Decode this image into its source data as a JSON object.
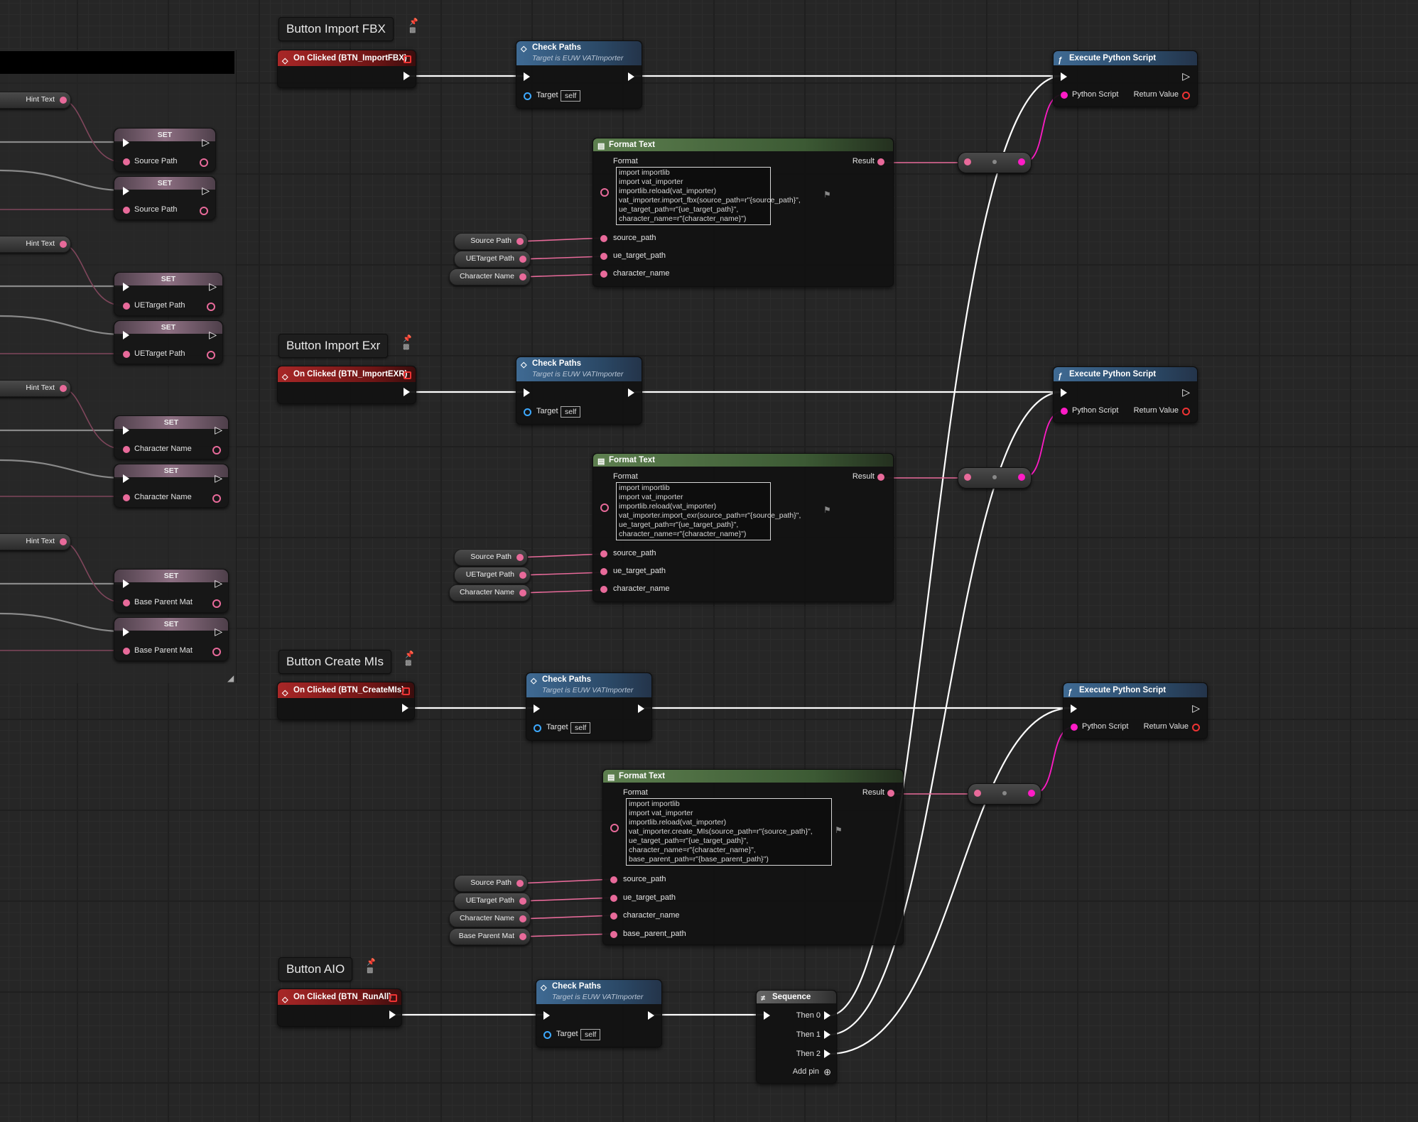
{
  "comments": [
    {
      "title": "Button Import FBX"
    },
    {
      "title": "Button Import Exr"
    },
    {
      "title": "Button Create MIs"
    },
    {
      "title": "Button AIO"
    }
  ],
  "events": [
    {
      "label": "On Clicked (BTN_ImportFBX)"
    },
    {
      "label": "On Clicked (BTN_ImportEXR)"
    },
    {
      "label": "On Clicked (BTN_CreateMIs)"
    },
    {
      "label": "On Clicked (BTN_RunAll)"
    }
  ],
  "check_paths": {
    "title": "Check Paths",
    "subtitle": "Target is EUW VATImporter",
    "target_label": "Target",
    "target_value": "self"
  },
  "format_text": {
    "title": "Format Text",
    "format_label": "Format",
    "result_label": "Result",
    "scripts": [
      "import importlib\nimport vat_importer\nimportlib.reload(vat_importer)\nvat_importer.import_fbx(source_path=r\"{source_path}\",\nue_target_path=r\"{ue_target_path}\",\ncharacter_name=r\"{character_name}\")",
      "import importlib\nimport vat_importer\nimportlib.reload(vat_importer)\nvat_importer.import_exr(source_path=r\"{source_path}\",\nue_target_path=r\"{ue_target_path}\",\ncharacter_name=r\"{character_name}\")",
      "import importlib\nimport vat_importer\nimportlib.reload(vat_importer)\nvat_importer.create_MIs(source_path=r\"{source_path}\",\nue_target_path=r\"{ue_target_path}\",\ncharacter_name=r\"{character_name}\",\nbase_parent_path=r\"{base_parent_path}\")"
    ],
    "args": [
      "source_path",
      "ue_target_path",
      "character_name",
      "base_parent_path"
    ]
  },
  "execute_python": {
    "title": "Execute Python Script",
    "input_label": "Python Script",
    "output_label": "Return Value"
  },
  "variables": {
    "source_path": "Source Path",
    "ue_target_path": "UETarget Path",
    "character_name": "Character Name",
    "base_parent_mat": "Base Parent Mat",
    "hint_text": "Hint Text",
    "set": "SET"
  },
  "sequence": {
    "title": "Sequence",
    "outputs": [
      "Then 0",
      "Then 1",
      "Then 2"
    ],
    "add_pin": "Add pin"
  },
  "colors": {
    "exec_wire": "#ffffff",
    "string_wire": "#e86a9a",
    "text_wire": "#ff1cc6",
    "event_header": "#a82727",
    "function_header": "#3f6a93",
    "format_header": "#5d7f4f"
  }
}
